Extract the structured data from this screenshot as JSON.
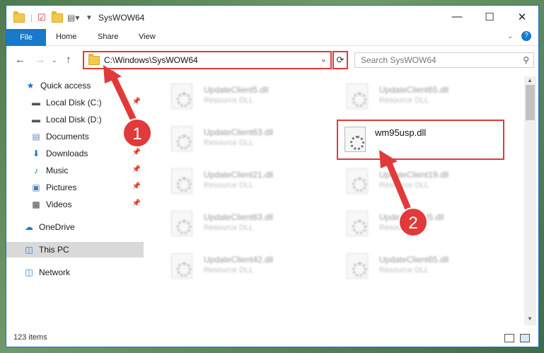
{
  "window": {
    "title": "SysWOW64"
  },
  "ribbon": {
    "tabs": [
      "File",
      "Home",
      "Share",
      "View"
    ]
  },
  "address": {
    "path": "C:\\Windows\\SysWOW64"
  },
  "search": {
    "placeholder": "Search SysWOW64"
  },
  "sidebar": {
    "items": [
      {
        "label": "Quick access",
        "icon": "star-icon"
      },
      {
        "label": "Local Disk (C:)",
        "icon": "drive-icon"
      },
      {
        "label": "Local Disk (D:)",
        "icon": "drive-icon"
      },
      {
        "label": "Documents",
        "icon": "documents-icon"
      },
      {
        "label": "Downloads",
        "icon": "download-icon"
      },
      {
        "label": "Music",
        "icon": "music-icon"
      },
      {
        "label": "Pictures",
        "icon": "pictures-icon"
      },
      {
        "label": "Videos",
        "icon": "videos-icon"
      },
      {
        "label": "OneDrive",
        "icon": "cloud-icon"
      },
      {
        "label": "This PC",
        "icon": "computer-icon"
      },
      {
        "label": "Network",
        "icon": "network-icon"
      }
    ]
  },
  "files": [
    {
      "name": "UpdateClient5.dll",
      "type": "Resource DLL"
    },
    {
      "name": "UpdateClient65.dll",
      "type": "Resource DLL"
    },
    {
      "name": "UpdateClient63.dll",
      "type": "Resource DLL"
    },
    {
      "name": "wm95usp.dll",
      "type": ""
    },
    {
      "name": "UpdateClient21.dll",
      "type": "Resource DLL"
    },
    {
      "name": "UpdateClient19.dll",
      "type": "Resource DLL"
    },
    {
      "name": "UpdateClient63.dll",
      "type": "Resource DLL"
    },
    {
      "name": "UpdateClient5.dll",
      "type": "Resource DLL"
    },
    {
      "name": "UpdateClient42.dll",
      "type": "Resource DLL"
    },
    {
      "name": "UpdateClient65.dll",
      "type": "Resource DLL"
    }
  ],
  "status": {
    "count": "123 items"
  },
  "annotations": {
    "marker1": "1",
    "marker2": "2",
    "color": "#e03a3a"
  }
}
